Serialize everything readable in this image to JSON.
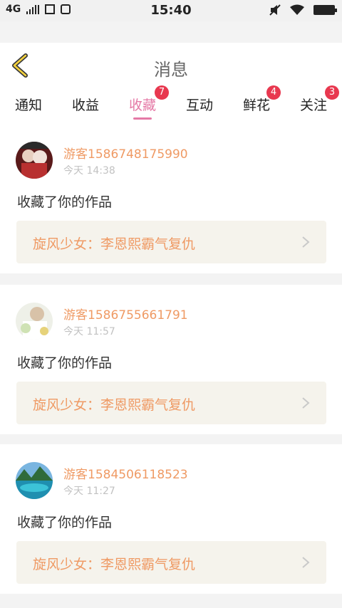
{
  "status_bar": {
    "network": "4G",
    "time": "15:40",
    "sim_icon": "sim-card-icon",
    "screenshot_icon": "crop-icon",
    "notification_icon": "download-icon",
    "mute_icon": "mute-icon",
    "wifi_icon": "wifi-icon",
    "battery_icon": "battery-icon"
  },
  "header": {
    "title": "消息",
    "back_icon": "back-chevron-icon"
  },
  "tabs": [
    {
      "label": "通知",
      "badge": ""
    },
    {
      "label": "收益",
      "badge": ""
    },
    {
      "label": "收藏",
      "badge": "7",
      "active": true
    },
    {
      "label": "互动",
      "badge": ""
    },
    {
      "label": "鲜花",
      "badge": "4"
    },
    {
      "label": "关注",
      "badge": "3"
    }
  ],
  "colors": {
    "accent": "#e579a6",
    "name": "#ef9a64",
    "badge": "#e8384f",
    "work_bg": "#f5f3ec"
  },
  "items": [
    {
      "username": "游客1586748175990",
      "time": "今天 14:38",
      "message": "收藏了你的作品",
      "work_title": "旋风少女：李恩熙霸气复仇"
    },
    {
      "username": "游客1586755661791",
      "time": "今天 11:57",
      "message": "收藏了你的作品",
      "work_title": "旋风少女：李恩熙霸气复仇"
    },
    {
      "username": "游客1584506118523",
      "time": "今天 11:27",
      "message": "收藏了你的作品",
      "work_title": "旋风少女：李恩熙霸气复仇"
    }
  ]
}
